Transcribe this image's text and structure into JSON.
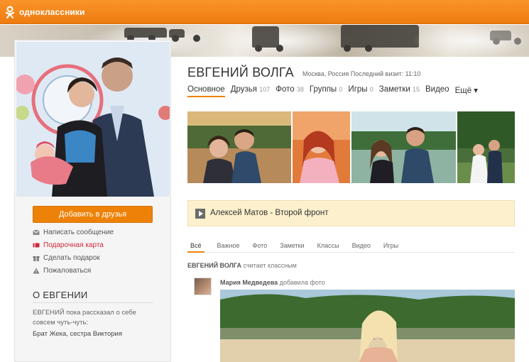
{
  "site": {
    "name": "одноклассники",
    "brand_color": "#ee8208"
  },
  "profile": {
    "name": "ЕВГЕНИЙ ВОЛГА",
    "meta": "Москва, Россия Последний визит: 11:10"
  },
  "nav": [
    {
      "label": "Основное",
      "count": ""
    },
    {
      "label": "Друзья",
      "count": "107"
    },
    {
      "label": "Фото",
      "count": "38"
    },
    {
      "label": "Группы",
      "count": "0"
    },
    {
      "label": "Игры",
      "count": "0"
    },
    {
      "label": "Заметки",
      "count": "15"
    },
    {
      "label": "Видео",
      "count": ""
    },
    {
      "label": "Ещё ▾",
      "count": ""
    }
  ],
  "sidebar": {
    "add_friend": "Добавить в друзья",
    "actions": [
      {
        "label": "Написать сообщение",
        "icon": "envelope-icon"
      },
      {
        "label": "Подарочная карта",
        "icon": "gift-card-icon"
      },
      {
        "label": "Сделать подарок",
        "icon": "gift-icon"
      },
      {
        "label": "Пожаловаться",
        "icon": "warning-icon"
      }
    ],
    "about_title": "О ЕВГЕНИИ",
    "about_text": "ЕВГЕНИЙ пока рассказал о себе совсем чуть-чуть:",
    "relatives": "Брат Жека, сестра Виктория"
  },
  "music": {
    "track": "Алексей Матов - Второй фронт"
  },
  "feed": {
    "tabs": [
      "Всё",
      "Важное",
      "Фото",
      "Заметки",
      "Классы",
      "Видео",
      "Игры"
    ],
    "event_actor": "ЕВГЕНИЙ ВОЛГА",
    "event_text": "считает классным",
    "post_author": "Мария Медведева",
    "post_action": "добавила фото"
  }
}
